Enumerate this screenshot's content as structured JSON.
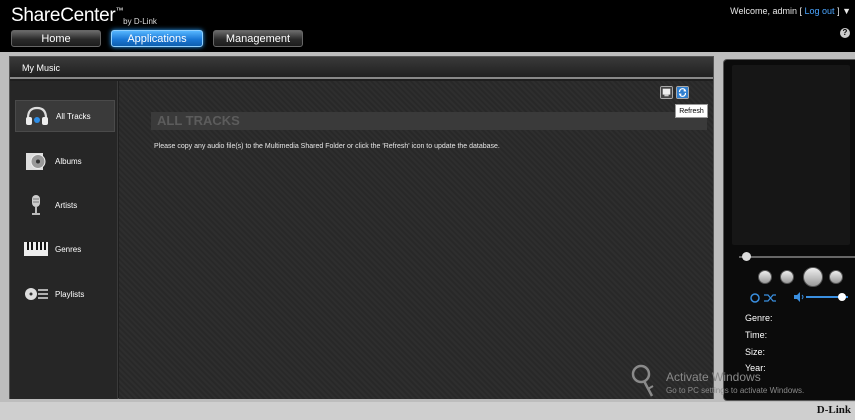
{
  "header": {
    "brand_name": "ShareCenter",
    "brand_tm": "™",
    "brand_by": "by D-Link",
    "welcome_prefix": "Welcome, admin [",
    "logout_label": "Log out",
    "welcome_suffix": "] ▼",
    "help_icon": "?",
    "tabs": [
      {
        "label": "Home",
        "active": false
      },
      {
        "label": "Applications",
        "active": true
      },
      {
        "label": "Management",
        "active": false
      }
    ]
  },
  "panel": {
    "title": "My Music",
    "sidebar": [
      {
        "label": "All Tracks",
        "icon": "headphones-icon",
        "selected": true
      },
      {
        "label": "Albums",
        "icon": "album-icon",
        "selected": false
      },
      {
        "label": "Artists",
        "icon": "microphone-icon",
        "selected": false
      },
      {
        "label": "Genres",
        "icon": "piano-icon",
        "selected": false
      },
      {
        "label": "Playlists",
        "icon": "playlist-icon",
        "selected": false
      }
    ],
    "page_title": "ALL TRACKS",
    "message": "Please copy any audio file(s) to the Multimedia Shared Folder or click the 'Refresh' icon to update the database.",
    "tooltip": "Refresh"
  },
  "player": {
    "meta_labels": [
      "Genre:",
      "Time:",
      "Size:",
      "Year:"
    ],
    "volume_level": 0.85,
    "seek_position": 0.0
  },
  "footer": {
    "logo": "D-Link"
  },
  "watermark": {
    "title": "Activate Windows",
    "subtitle": "Go to PC settings to activate Windows."
  },
  "colors": {
    "accent_blue": "#1b78d6",
    "link_blue": "#4aa5ff"
  }
}
